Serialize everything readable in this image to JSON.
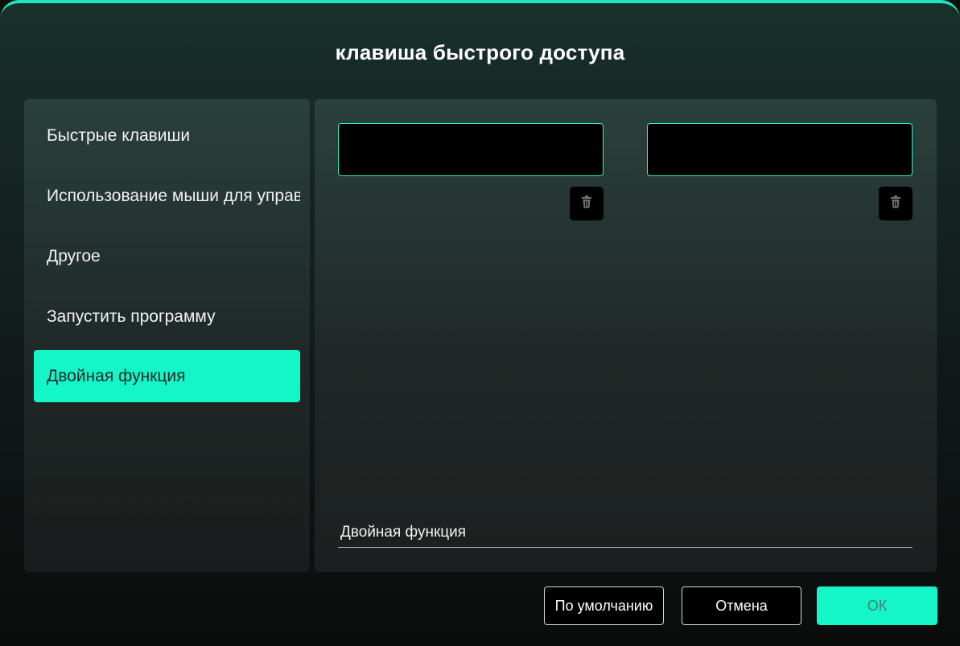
{
  "dialog": {
    "title": "клавиша быстрого доступа"
  },
  "sidebar": {
    "items": [
      {
        "label": "Быстрые клавиши",
        "active": false
      },
      {
        "label": "Использование мыши для управления",
        "active": false
      },
      {
        "label": "Другое",
        "active": false
      },
      {
        "label": "Запустить программу",
        "active": false
      },
      {
        "label": "Двойная функция",
        "active": true
      }
    ]
  },
  "content": {
    "key_field_1": {
      "value": "",
      "placeholder": ""
    },
    "key_field_2": {
      "value": "",
      "placeholder": ""
    },
    "delete_icon": "trash-icon",
    "function_label": "Двойная функция"
  },
  "footer": {
    "default_label": "По умолчанию",
    "cancel_label": "Отмена",
    "ok_label": "ОК"
  },
  "colors": {
    "accent": "#14f5c8",
    "panel": "#24332f",
    "field_bg": "#000000"
  }
}
